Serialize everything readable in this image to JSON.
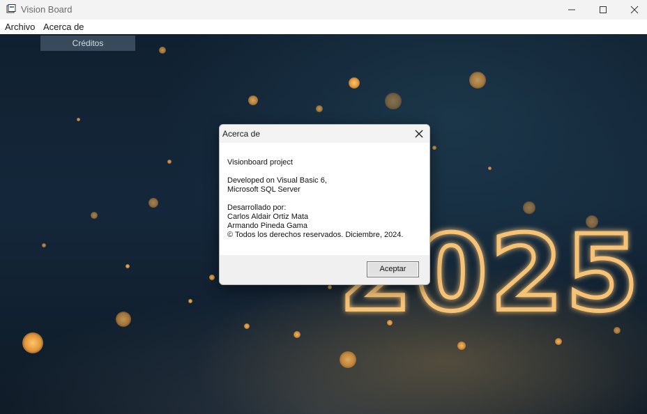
{
  "window": {
    "title": "Vision Board"
  },
  "menu": {
    "archivo": "Archivo",
    "acerca_de": "Acerca de"
  },
  "dropdown": {
    "creditos": "Créditos"
  },
  "background": {
    "year_text": "2025"
  },
  "dialog": {
    "title": "Acerca de",
    "line1": "Visionboard project",
    "line2": "Developed on Visual Basic 6,",
    "line3": "Microsoft SQL Server",
    "line4": "Desarrollado por:",
    "line5": "Carlos Aldair Ortiz Mata",
    "line6": "Armando Pineda Gama",
    "line7": "© Todos los derechos reservados. Diciembre, 2024.",
    "ok_label": "Aceptar"
  },
  "icons": {
    "app": "app-icon",
    "minimize": "minimize-icon",
    "maximize": "maximize-icon",
    "close": "close-icon"
  },
  "colors": {
    "accent_glow": "#f0b060",
    "background": "#14273a"
  }
}
